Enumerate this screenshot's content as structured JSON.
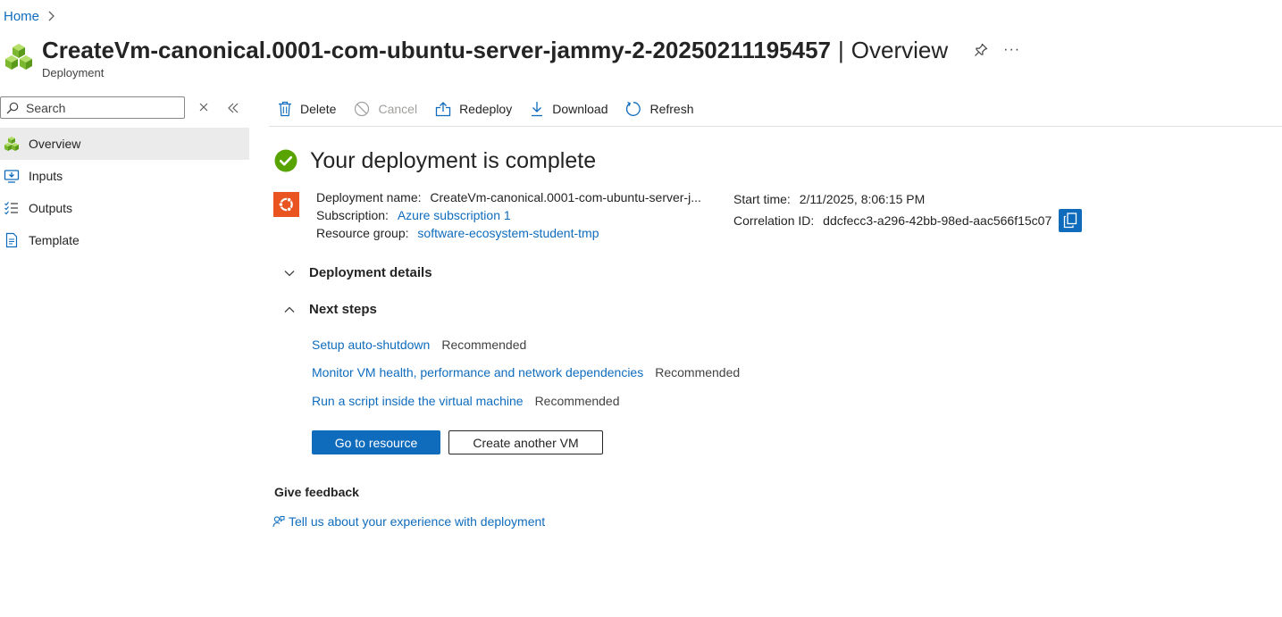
{
  "breadcrumb": {
    "home": "Home"
  },
  "header": {
    "title": "CreateVm-canonical.0001-com-ubuntu-server-jammy-2-20250211195457",
    "separator": "|",
    "view": "Overview",
    "subtitle": "Deployment",
    "more_label": "···"
  },
  "sidebar": {
    "search_placeholder": "Search",
    "items": [
      {
        "label": "Overview",
        "icon": "deployment-cubes-icon",
        "active": true
      },
      {
        "label": "Inputs",
        "icon": "inputs-icon"
      },
      {
        "label": "Outputs",
        "icon": "outputs-list-icon"
      },
      {
        "label": "Template",
        "icon": "template-document-icon"
      }
    ]
  },
  "toolbar": {
    "delete": "Delete",
    "cancel": "Cancel",
    "redeploy": "Redeploy",
    "download": "Download",
    "refresh": "Refresh"
  },
  "status": {
    "title": "Your deployment is complete",
    "color": "#57a300"
  },
  "details": {
    "deployment_name_label": "Deployment name:",
    "deployment_name_value": "CreateVm-canonical.0001-com-ubuntu-server-j...",
    "subscription_label": "Subscription:",
    "subscription_value": "Azure subscription 1",
    "resource_group_label": "Resource group:",
    "resource_group_value": "software-ecosystem-student-tmp",
    "start_time_label": "Start time:",
    "start_time_value": "2/11/2025, 8:06:15 PM",
    "correlation_label": "Correlation ID:",
    "correlation_value": "ddcfecc3-a296-42bb-98ed-aac566f15c07"
  },
  "sections": {
    "deployment_details": "Deployment details",
    "next_steps": "Next steps"
  },
  "next_steps": [
    {
      "link": "Setup auto-shutdown",
      "badge": "Recommended"
    },
    {
      "link": "Monitor VM health, performance and network dependencies",
      "badge": "Recommended"
    },
    {
      "link": "Run a script inside the virtual machine",
      "badge": "Recommended"
    }
  ],
  "actions": {
    "primary": "Go to resource",
    "secondary": "Create another VM"
  },
  "feedback": {
    "title": "Give feedback",
    "link": "Tell us about your experience with deployment"
  },
  "colors": {
    "accent": "#0f6cbd",
    "ubuntu": "#e95420",
    "success": "#57a300"
  }
}
